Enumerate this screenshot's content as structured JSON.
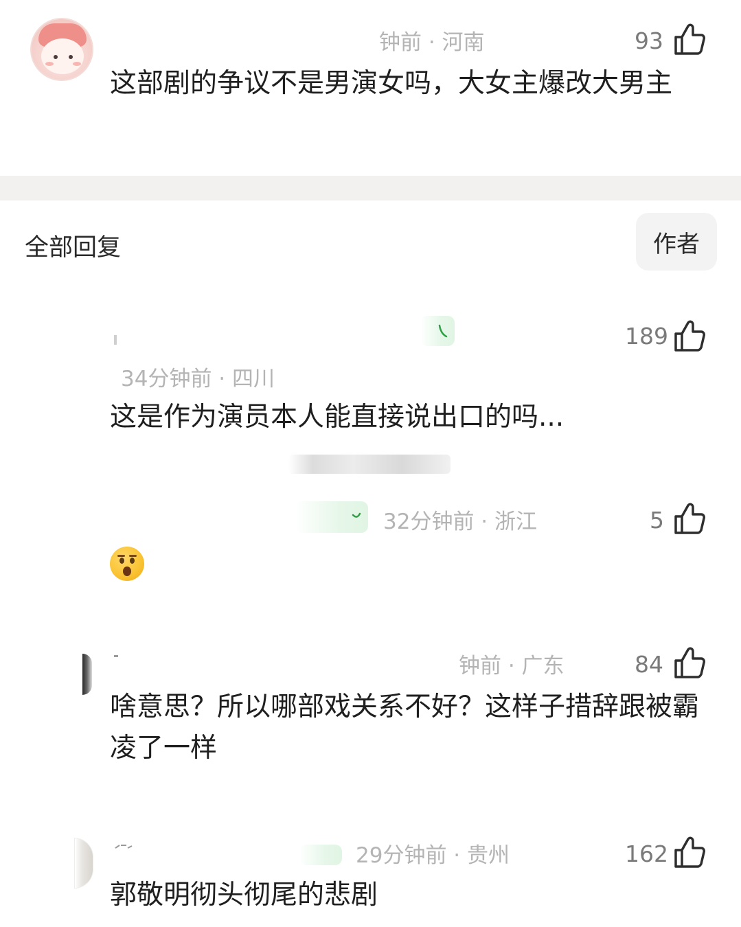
{
  "main_comment": {
    "time_location": "钟前 · 河南",
    "likes": "93",
    "text": "这部剧的争议不是男演女吗，大女主爆改大男主"
  },
  "replies_header": {
    "all_replies_label": "全部回复",
    "author_filter_label": "作者"
  },
  "replies": [
    {
      "time_location": "34分钟前 · 四川",
      "likes": "189",
      "text": "这是作为演员本人能直接说出口的吗..."
    },
    {
      "time_location": "32分钟前 · 浙江",
      "likes": "5",
      "text": ""
    },
    {
      "time_location": "钟前 · 广东",
      "likes": "84",
      "text": "啥意思？所以哪部戏关系不好？这样子措辞跟被霸凌了一样"
    },
    {
      "time_location": "29分钟前 · 贵州",
      "likes": "162",
      "text": "郭敬明彻头彻尾的悲剧"
    }
  ],
  "icons": {
    "like": "thumbs-up-icon",
    "reaction_emoji": "astonished-face-icon"
  },
  "colors": {
    "meta_text": "#b4b4b4",
    "divider": "#f2f1ef",
    "badge_green": "#e1f5e4"
  }
}
